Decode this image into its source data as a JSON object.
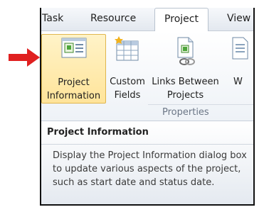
{
  "tabs": [
    {
      "label": "Task"
    },
    {
      "label": "Resource"
    },
    {
      "label": "Project"
    },
    {
      "label": "View"
    }
  ],
  "commands": [
    {
      "line1": "Project",
      "line2": "Information",
      "icon": "project-info-icon"
    },
    {
      "line1": "Custom",
      "line2": "Fields",
      "icon": "custom-fields-icon"
    },
    {
      "line1": "Links Between",
      "line2": "Projects",
      "icon": "links-between-projects-icon"
    },
    {
      "line1": "W",
      "line2": "",
      "icon": "wbs-icon"
    }
  ],
  "group": {
    "label": "Properties"
  },
  "tooltip": {
    "title": "Project Information",
    "body": "Display the Project Information dialog box to update various aspects of the project, such as start date and status date."
  },
  "colors": {
    "arrow": "#e02020",
    "hover_fill": "#ffe49a",
    "hover_border": "#e0b64e"
  }
}
